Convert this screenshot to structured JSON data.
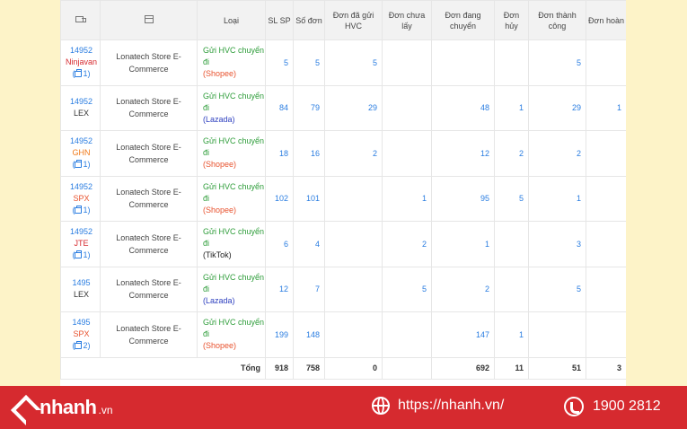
{
  "table": {
    "headers": {
      "type": "Loại",
      "sl_sp": "SL SP",
      "so_don": "Số đơn",
      "da_gui": "Đơn đã gửi HVC",
      "chua_lay": "Đơn chưa lấy",
      "dang_chuyen": "Đơn đang chuyển",
      "huy": "Đơn hủy",
      "thanh_cong": "Đơn thành công",
      "hoan": "Đơn hoàn"
    },
    "rows": [
      {
        "code": "14952",
        "carrier": "Ninjavan",
        "carrier_color": "#d62a2f",
        "count": "1",
        "store": "Lonatech Store E-Commerce",
        "type_line": "Gửi HVC chuyển đi",
        "channel": "(Shopee)",
        "channel_color": "#e8532f",
        "sl_sp": "5",
        "so_don": "5",
        "da_gui": "5",
        "chua_lay": "",
        "dang_chuyen": "",
        "huy": "",
        "thanh_cong": "5",
        "hoan": ""
      },
      {
        "code": "14952",
        "carrier": "LEX",
        "carrier_color": "#333333",
        "count": "",
        "store": "Lonatech Store E-Commerce",
        "type_line": "Gửi HVC chuyển đi",
        "channel": "(Lazada)",
        "channel_color": "#2d3fbf",
        "sl_sp": "84",
        "so_don": "79",
        "da_gui": "29",
        "chua_lay": "",
        "dang_chuyen": "48",
        "huy": "1",
        "thanh_cong": "29",
        "hoan": "1"
      },
      {
        "code": "14952",
        "carrier": "GHN",
        "carrier_color": "#f07a1a",
        "count": "1",
        "store": "Lonatech Store E-Commerce",
        "type_line": "Gửi HVC chuyển đi",
        "channel": "(Shopee)",
        "channel_color": "#e8532f",
        "sl_sp": "18",
        "so_don": "16",
        "da_gui": "2",
        "chua_lay": "",
        "dang_chuyen": "12",
        "huy": "2",
        "thanh_cong": "2",
        "hoan": ""
      },
      {
        "code": "14952",
        "carrier": "SPX",
        "carrier_color": "#e8532f",
        "count": "1",
        "store": "Lonatech Store E-Commerce",
        "type_line": "Gửi HVC chuyển đi",
        "channel": "(Shopee)",
        "channel_color": "#e8532f",
        "sl_sp": "102",
        "so_don": "101",
        "da_gui": "",
        "chua_lay": "1",
        "dang_chuyen": "95",
        "huy": "5",
        "thanh_cong": "1",
        "hoan": ""
      },
      {
        "code": "14952",
        "carrier": "JTE",
        "carrier_color": "#d62a2f",
        "count": "1",
        "store": "Lonatech Store E-Commerce",
        "type_line": "Gửi HVC chuyển đi",
        "channel": "(TikTok)",
        "channel_color": "#222222",
        "sl_sp": "6",
        "so_don": "4",
        "da_gui": "",
        "chua_lay": "2",
        "dang_chuyen": "1",
        "huy": "",
        "thanh_cong": "3",
        "hoan": ""
      },
      {
        "code": "1495",
        "carrier": "LEX",
        "carrier_color": "#333333",
        "count": "",
        "store": "Lonatech Store E-Commerce",
        "type_line": "Gửi HVC chuyển đi",
        "channel": "(Lazada)",
        "channel_color": "#2d3fbf",
        "sl_sp": "12",
        "so_don": "7",
        "da_gui": "",
        "chua_lay": "5",
        "dang_chuyen": "2",
        "huy": "",
        "thanh_cong": "5",
        "hoan": ""
      },
      {
        "code": "1495",
        "carrier": "SPX",
        "carrier_color": "#e8532f",
        "count": "2",
        "store": "Lonatech Store E-Commerce",
        "type_line": "Gửi HVC chuyển đi",
        "channel": "(Shopee)",
        "channel_color": "#e8532f",
        "sl_sp": "199",
        "so_don": "148",
        "da_gui": "",
        "chua_lay": "",
        "dang_chuyen": "147",
        "huy": "1",
        "thanh_cong": "",
        "hoan": ""
      }
    ],
    "total": {
      "label": "Tổng",
      "sl_sp": "918",
      "so_don": "758",
      "da_gui": "0",
      "chua_lay": "",
      "dang_chuyen": "692",
      "huy": "11",
      "thanh_cong": "51",
      "hoan": "3"
    }
  },
  "footer": {
    "brand": "nhanh",
    "brand_suffix": ".vn",
    "website": "https://nhanh.vn/",
    "phone": "1900 2812"
  },
  "icons": {
    "carrier_column": "truck-icon",
    "store_column": "store-icon",
    "print_count": "printer-icon",
    "website": "globe-icon",
    "phone": "phone-icon"
  }
}
